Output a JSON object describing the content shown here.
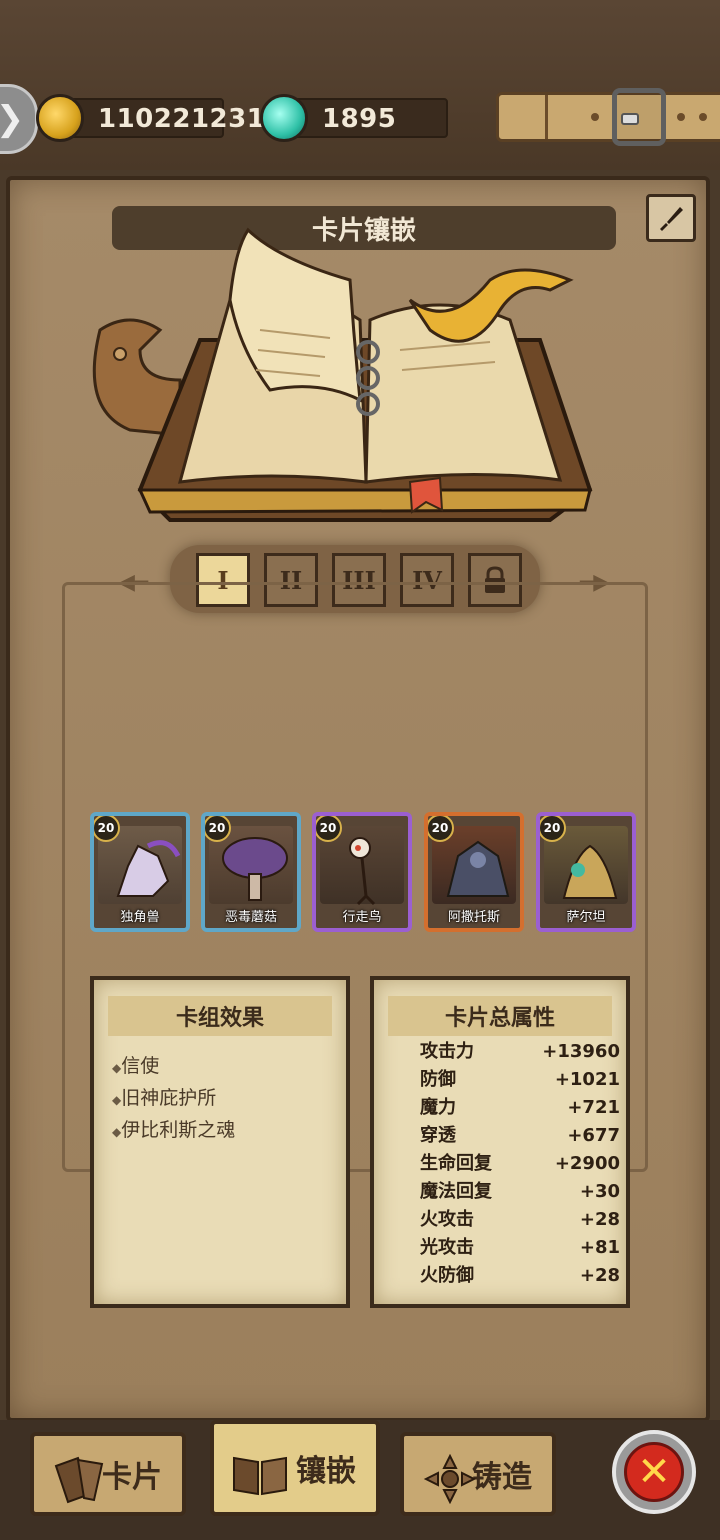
{
  "header": {
    "gold_amount": "110221231",
    "gem_amount": "1895"
  },
  "panel": {
    "title": "卡片镶嵌"
  },
  "tabs": [
    {
      "label": "I",
      "active": true
    },
    {
      "label": "II",
      "active": false
    },
    {
      "label": "III",
      "active": false
    },
    {
      "label": "IV",
      "active": false
    },
    {
      "label": "",
      "icon": "lock-icon",
      "active": false
    }
  ],
  "cards": [
    {
      "name": "独角兽",
      "level": "20",
      "rarity": "blue"
    },
    {
      "name": "恶毒蘑菇",
      "level": "20",
      "rarity": "blue"
    },
    {
      "name": "行走鸟",
      "level": "20",
      "rarity": "purple"
    },
    {
      "name": "阿撒托斯",
      "level": "20",
      "rarity": "orange"
    },
    {
      "name": "萨尔坦",
      "level": "20",
      "rarity": "purple"
    }
  ],
  "deck_effects": {
    "title": "卡组效果",
    "items": [
      "信使",
      "旧神庇护所",
      "伊比利斯之魂"
    ]
  },
  "card_attributes": {
    "title": "卡片总属性",
    "rows": [
      {
        "label": "攻击力",
        "value": "+13960"
      },
      {
        "label": "防御",
        "value": "+1021"
      },
      {
        "label": "魔力",
        "value": "+721"
      },
      {
        "label": "穿透",
        "value": "+677"
      },
      {
        "label": "生命回复",
        "value": "+2900"
      },
      {
        "label": "魔法回复",
        "value": "+30"
      },
      {
        "label": "火攻击",
        "value": "+28"
      },
      {
        "label": "光攻击",
        "value": "+81"
      },
      {
        "label": "火防御",
        "value": "+28"
      }
    ]
  },
  "bottom_nav": {
    "cards_label": "卡片",
    "inlay_label": "镶嵌",
    "forge_label": "铸造"
  },
  "colors": {
    "panel": "#a58a68",
    "parchment": "#e9dcb6",
    "active_tab": "#ecd79a",
    "close_red": "#d32a1e"
  }
}
